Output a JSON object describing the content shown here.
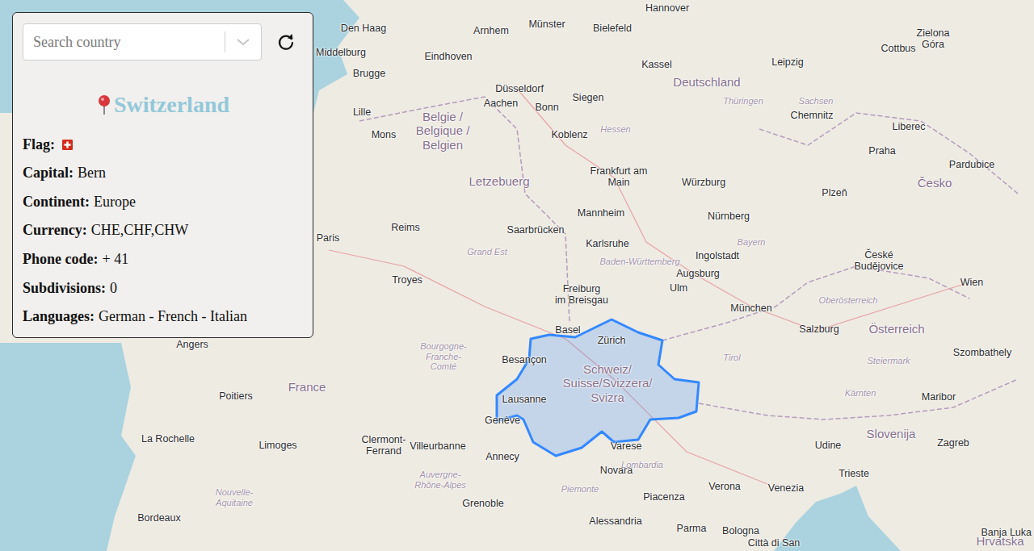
{
  "search": {
    "placeholder": "Search country"
  },
  "country": {
    "title": "Switzerland"
  },
  "fields": [
    {
      "label": "Flag:",
      "kind": "flag"
    },
    {
      "label": "Capital:",
      "value": "Bern",
      "kind": "text"
    },
    {
      "label": "Continent:",
      "value": "Europe",
      "kind": "text"
    },
    {
      "label": "Currency:",
      "value": "CHE,CHF,CHW",
      "kind": "text"
    },
    {
      "label": "Phone code:",
      "value": "+ 41",
      "kind": "text"
    },
    {
      "label": "Subdivisions:",
      "value": "0",
      "kind": "text"
    },
    {
      "label": "Languages:",
      "value": "German - French - Italian",
      "kind": "text"
    }
  ],
  "map": {
    "labels": [
      {
        "text": "Hannover",
        "kind": "city"
      },
      {
        "text": "Den Haag",
        "kind": "city"
      },
      {
        "text": "Arnhem",
        "kind": "city"
      },
      {
        "text": "Münster",
        "kind": "city"
      },
      {
        "text": "Bielefeld",
        "kind": "city"
      },
      {
        "text": "Leipzig",
        "kind": "city"
      },
      {
        "text": "Middelburg",
        "kind": "city"
      },
      {
        "text": "Eindhoven",
        "kind": "city"
      },
      {
        "text": "Brugge",
        "kind": "city"
      },
      {
        "text": "Kassel",
        "kind": "city"
      },
      {
        "text": "Düsseldorf",
        "kind": "city"
      },
      {
        "text": "Cottbus",
        "kind": "city"
      },
      {
        "text": "Zielona\nGóra",
        "kind": "city"
      },
      {
        "text": "Lille",
        "kind": "city"
      },
      {
        "text": "Aachen",
        "kind": "city"
      },
      {
        "text": "Bonn",
        "kind": "city"
      },
      {
        "text": "Siegen",
        "kind": "city"
      },
      {
        "text": "Chemnitz",
        "kind": "city"
      },
      {
        "text": "Liberec",
        "kind": "city"
      },
      {
        "text": "Mons",
        "kind": "city"
      },
      {
        "text": "Koblenz",
        "kind": "city"
      },
      {
        "text": "Praha",
        "kind": "city"
      },
      {
        "text": "Pardubice",
        "kind": "city"
      },
      {
        "text": "Frankfurt am\nMain",
        "kind": "city"
      },
      {
        "text": "Würzburg",
        "kind": "city"
      },
      {
        "text": "Plzeň",
        "kind": "city"
      },
      {
        "text": "Mannheim",
        "kind": "city"
      },
      {
        "text": "Nürnberg",
        "kind": "city"
      },
      {
        "text": "Reims",
        "kind": "city"
      },
      {
        "text": "Paris",
        "kind": "city"
      },
      {
        "text": "Saarbrücken",
        "kind": "city"
      },
      {
        "text": "Karlsruhe",
        "kind": "city"
      },
      {
        "text": "Ingolstadt",
        "kind": "city"
      },
      {
        "text": "České\nBudějovice",
        "kind": "city"
      },
      {
        "text": "Troyes",
        "kind": "city"
      },
      {
        "text": "Augsburg",
        "kind": "city"
      },
      {
        "text": "Freiburg\nim Breisgau",
        "kind": "city"
      },
      {
        "text": "Ulm",
        "kind": "city"
      },
      {
        "text": "Wien",
        "kind": "city"
      },
      {
        "text": "München",
        "kind": "city"
      },
      {
        "text": "Basel",
        "kind": "city"
      },
      {
        "text": "Zürich",
        "kind": "city"
      },
      {
        "text": "Salzburg",
        "kind": "city"
      },
      {
        "text": "Szombathely",
        "kind": "city"
      },
      {
        "text": "Besançon",
        "kind": "city"
      },
      {
        "text": "Lausanne",
        "kind": "city"
      },
      {
        "text": "Genève",
        "kind": "city"
      },
      {
        "text": "Varese",
        "kind": "city"
      },
      {
        "text": "Poitiers",
        "kind": "city"
      },
      {
        "text": "Limoges",
        "kind": "city"
      },
      {
        "text": "Clermont-\nFerrand",
        "kind": "city"
      },
      {
        "text": "Villeurbanne",
        "kind": "city"
      },
      {
        "text": "Annecy",
        "kind": "city"
      },
      {
        "text": "Maribor",
        "kind": "city"
      },
      {
        "text": "Udine",
        "kind": "city"
      },
      {
        "text": "Zagreb",
        "kind": "city"
      },
      {
        "text": "Novara",
        "kind": "city"
      },
      {
        "text": "Trieste",
        "kind": "city"
      },
      {
        "text": "Venezia",
        "kind": "city"
      },
      {
        "text": "Verona",
        "kind": "city"
      },
      {
        "text": "Piacenza",
        "kind": "city"
      },
      {
        "text": "Grenoble",
        "kind": "city"
      },
      {
        "text": "Alessandria",
        "kind": "city"
      },
      {
        "text": "Parma",
        "kind": "city"
      },
      {
        "text": "Bologna",
        "kind": "city"
      },
      {
        "text": "Bordeaux",
        "kind": "city"
      },
      {
        "text": "La Rochelle",
        "kind": "city"
      },
      {
        "text": "Angers",
        "kind": "city"
      },
      {
        "text": "Città di San",
        "kind": "city"
      },
      {
        "text": "Banja Luka",
        "kind": "city"
      },
      {
        "text": "Deutschland",
        "kind": "country"
      },
      {
        "text": "Belgie /\nBelgique /\nBelgien",
        "kind": "country"
      },
      {
        "text": "Letzebuerg",
        "kind": "country"
      },
      {
        "text": "France",
        "kind": "country"
      },
      {
        "text": "Česko",
        "kind": "country"
      },
      {
        "text": "Österreich",
        "kind": "country"
      },
      {
        "text": "Schweiz/\nSuisse/Svizzera/\nSvizra",
        "kind": "country"
      },
      {
        "text": "Slovenija",
        "kind": "country"
      },
      {
        "text": "Hrvatska",
        "kind": "country"
      },
      {
        "text": "Hessen",
        "kind": "region"
      },
      {
        "text": "Thüringen",
        "kind": "region"
      },
      {
        "text": "Sachsen",
        "kind": "region"
      },
      {
        "text": "Grand Est",
        "kind": "region"
      },
      {
        "text": "Baden-Württemberg",
        "kind": "region"
      },
      {
        "text": "Bayern",
        "kind": "region"
      },
      {
        "text": "Bourgogne-\nFranche-\nComté",
        "kind": "region"
      },
      {
        "text": "Tirol",
        "kind": "region"
      },
      {
        "text": "Steiermark",
        "kind": "region"
      },
      {
        "text": "Kärnten",
        "kind": "region"
      },
      {
        "text": "Oberösterreich",
        "kind": "region"
      },
      {
        "text": "Lombardia",
        "kind": "region"
      },
      {
        "text": "Piemonte",
        "kind": "region"
      },
      {
        "text": "Auvergne-\nRhône-Alpes",
        "kind": "region"
      },
      {
        "text": "Nouvelle-\nAquitaine",
        "kind": "region"
      }
    ]
  }
}
